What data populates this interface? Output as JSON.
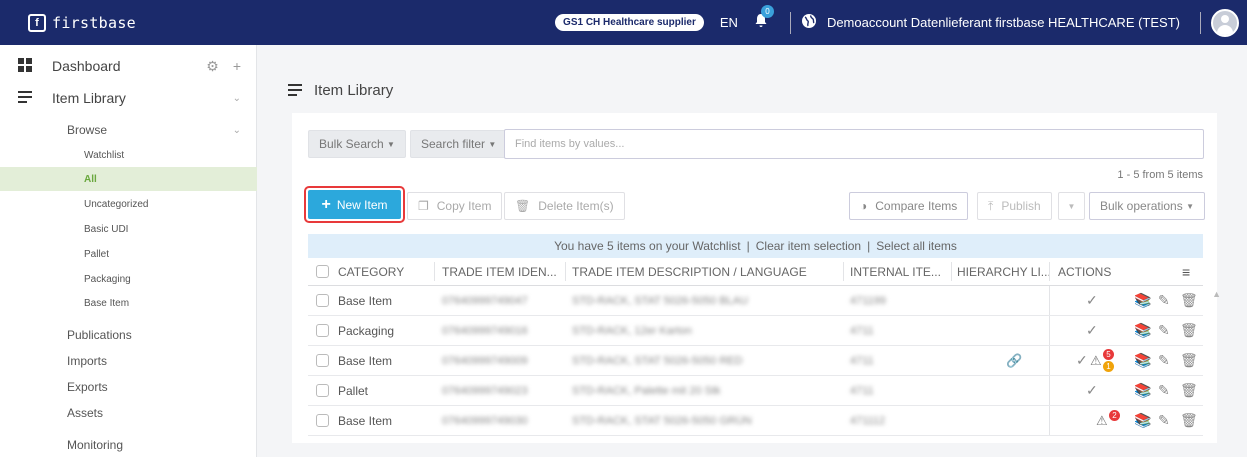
{
  "topbar": {
    "logo_text": "firstbase",
    "logo_icon": "f-logo-icon",
    "supplier_badge": "GS1 CH Healthcare supplier",
    "language": "EN",
    "notification_count": "0",
    "account_name": "Demoaccount Datenlieferant firstbase HEALTHCARE (TEST)",
    "brand_color": "#1b2a6b"
  },
  "sidebar": {
    "dashboard": "Dashboard",
    "item_library": "Item Library",
    "browse": "Browse",
    "browse_items": [
      "Watchlist",
      "All",
      "Uncategorized",
      "Basic UDI",
      "Pallet",
      "Packaging",
      "Base Item"
    ],
    "active_item": "All",
    "sections": [
      "Publications",
      "Imports",
      "Exports",
      "Assets",
      "Monitoring"
    ]
  },
  "main": {
    "title": "Item Library",
    "bulk_search_label": "Bulk Search",
    "search_filter_label": "Search filter",
    "search_placeholder": "Find items by values...",
    "count_text": "1 - 5 from 5 items",
    "new_item_label": "New Item",
    "copy_item_label": "Copy Item",
    "delete_items_label": "Delete Item(s)",
    "compare_items_label": "Compare Items",
    "publish_label": "Publish",
    "bulk_operations_label": "Bulk operations",
    "watch_banner": {
      "text": "You have 5 items on your Watchlist",
      "clear": "Clear item selection",
      "select_all": "Select all items"
    },
    "columns": {
      "category": "CATEGORY",
      "gtin": "TRADE ITEM IDEN...",
      "description": "TRADE ITEM DESCRIPTION / LANGUAGE",
      "internal": "INTERNAL ITE...",
      "hierarchy": "HIERARCHY LI...",
      "actions": "ACTIONS"
    },
    "rows": [
      {
        "category": "Base Item",
        "gtin": "07640999749047",
        "description": "STD-RACK, STAT 5026-5050 BLAU",
        "internal": "471199",
        "hierarchy_link": false,
        "validated": true,
        "errors": "",
        "warnings": ""
      },
      {
        "category": "Packaging",
        "gtin": "07640999749016",
        "description": "STD-RACK, 12er Karton",
        "internal": "4711",
        "hierarchy_link": false,
        "validated": true,
        "errors": "",
        "warnings": ""
      },
      {
        "category": "Base Item",
        "gtin": "07640999749009",
        "description": "STD-RACK, STAT 5026-5050 RED",
        "internal": "4711",
        "hierarchy_link": true,
        "validated": true,
        "errors": "5",
        "warnings": "1"
      },
      {
        "category": "Pallet",
        "gtin": "07640999749023",
        "description": "STD-RACK, Palette mit 20 Stk",
        "internal": "4711",
        "hierarchy_link": false,
        "validated": true,
        "errors": "",
        "warnings": ""
      },
      {
        "category": "Base Item",
        "gtin": "07640999749030",
        "description": "STD-RACK, STAT 5026-5050 GRÜN",
        "internal": "471112",
        "hierarchy_link": false,
        "validated": false,
        "errors": "2",
        "warnings": ""
      }
    ],
    "colors": {
      "accent": "#2ca8dc",
      "active_green": "#6aa83e",
      "error": "#e8393a",
      "warning": "#f0a30a"
    }
  }
}
